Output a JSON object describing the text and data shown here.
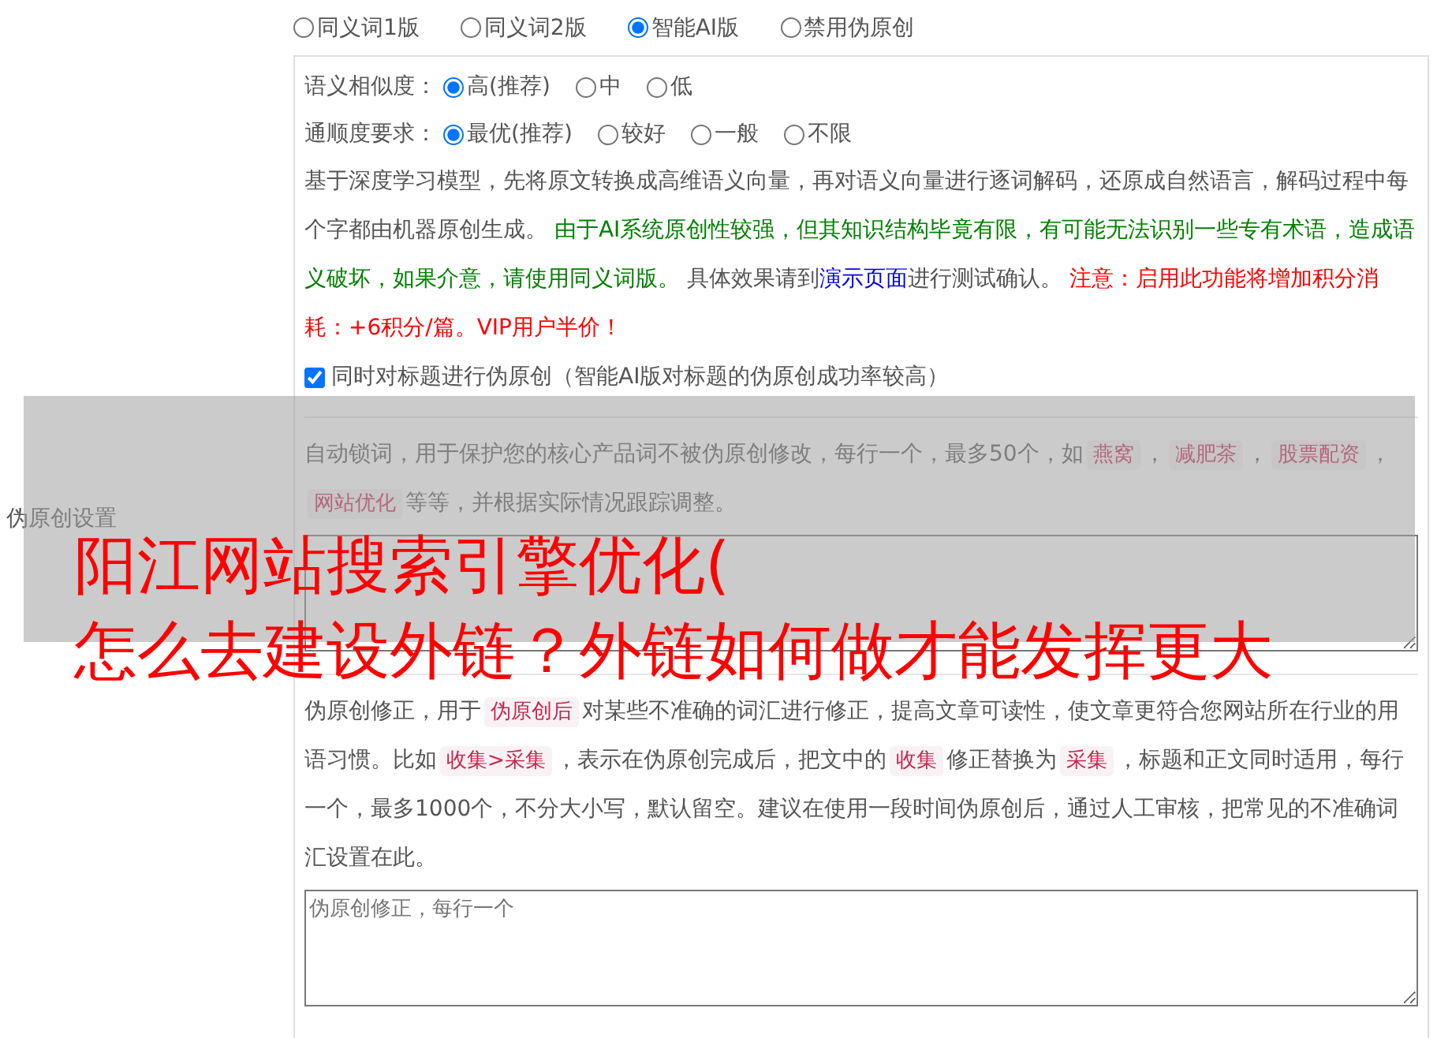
{
  "section_label": "伪原创设置",
  "mode_options": [
    {
      "label": "同义词1版",
      "selected": false
    },
    {
      "label": "同义词2版",
      "selected": false
    },
    {
      "label": "智能AI版",
      "selected": true
    },
    {
      "label": "禁用伪原创",
      "selected": false
    }
  ],
  "similarity": {
    "label": "语义相似度：",
    "options": [
      {
        "label": "高(推荐)",
        "selected": true
      },
      {
        "label": "中",
        "selected": false
      },
      {
        "label": "低",
        "selected": false
      }
    ]
  },
  "fluency": {
    "label": "通顺度要求：",
    "options": [
      {
        "label": "最优(推荐)",
        "selected": true
      },
      {
        "label": "较好",
        "selected": false
      },
      {
        "label": "一般",
        "selected": false
      },
      {
        "label": "不限",
        "selected": false
      }
    ]
  },
  "ai_description": [
    {
      "kind": "text",
      "text": "基于深度学习模型，先将原文转换成高维语义向量，再对语义向量进行逐词解码，还原成自然语言，解码过程中每个字都由机器原创生成。 "
    },
    {
      "kind": "green",
      "text": "由于AI系统原创性较强，但其知识结构毕竟有限，有可能无法识别一些专有术语，造成语义破坏，如果介意，请使用同义词版。"
    },
    {
      "kind": "text",
      "text": " 具体效果请到"
    },
    {
      "kind": "link",
      "text": "演示页面"
    },
    {
      "kind": "text",
      "text": "进行测试确认。 "
    },
    {
      "kind": "red",
      "text": "注意：启用此功能将增加积分消耗：+6积分/篇。VIP用户半价！"
    }
  ],
  "title_checkbox": {
    "label": "同时对标题进行伪原创（智能AI版对标题的伪原创成功率较高）",
    "checked": true
  },
  "lock_words": {
    "description": [
      {
        "kind": "text",
        "text": "自动锁词，用于保护您的核心产品词不被伪原创修改，每行一个，最多50个，如"
      },
      {
        "kind": "code",
        "text": "燕窝"
      },
      {
        "kind": "text",
        "text": "，"
      },
      {
        "kind": "code",
        "text": "减肥茶"
      },
      {
        "kind": "text",
        "text": "，"
      },
      {
        "kind": "code",
        "text": "股票配资"
      },
      {
        "kind": "text",
        "text": "，"
      },
      {
        "kind": "code",
        "text": "网站优化"
      },
      {
        "kind": "text",
        "text": "等等，并根据实际情况跟踪调整。"
      }
    ]
  },
  "correction": {
    "description": [
      {
        "kind": "text",
        "text": "伪原创修正，用于"
      },
      {
        "kind": "code",
        "text": "伪原创后"
      },
      {
        "kind": "text",
        "text": "对某些不准确的词汇进行修正，提高文章可读性，使文章更符合您网站所在行业的用语习惯。比如"
      },
      {
        "kind": "code",
        "text": "收集>采集"
      },
      {
        "kind": "text",
        "text": "，表示在伪原创完成后，把文中的"
      },
      {
        "kind": "code",
        "text": "收集"
      },
      {
        "kind": "text",
        "text": "修正替换为"
      },
      {
        "kind": "code",
        "text": "采集"
      },
      {
        "kind": "text",
        "text": "，标题和正文同时适用，每行一个，最多1000个，不分大小写，默认留空。建议在使用一段时间伪原创后，通过人工审核，把常见的不准确词汇设置在此。"
      }
    ],
    "placeholder": "伪原创修正，每行一个"
  },
  "overlay_title": [
    "阳江网站搜索引擎优化(",
    "怎么去建设外链？外链如何做才能发挥更大"
  ]
}
